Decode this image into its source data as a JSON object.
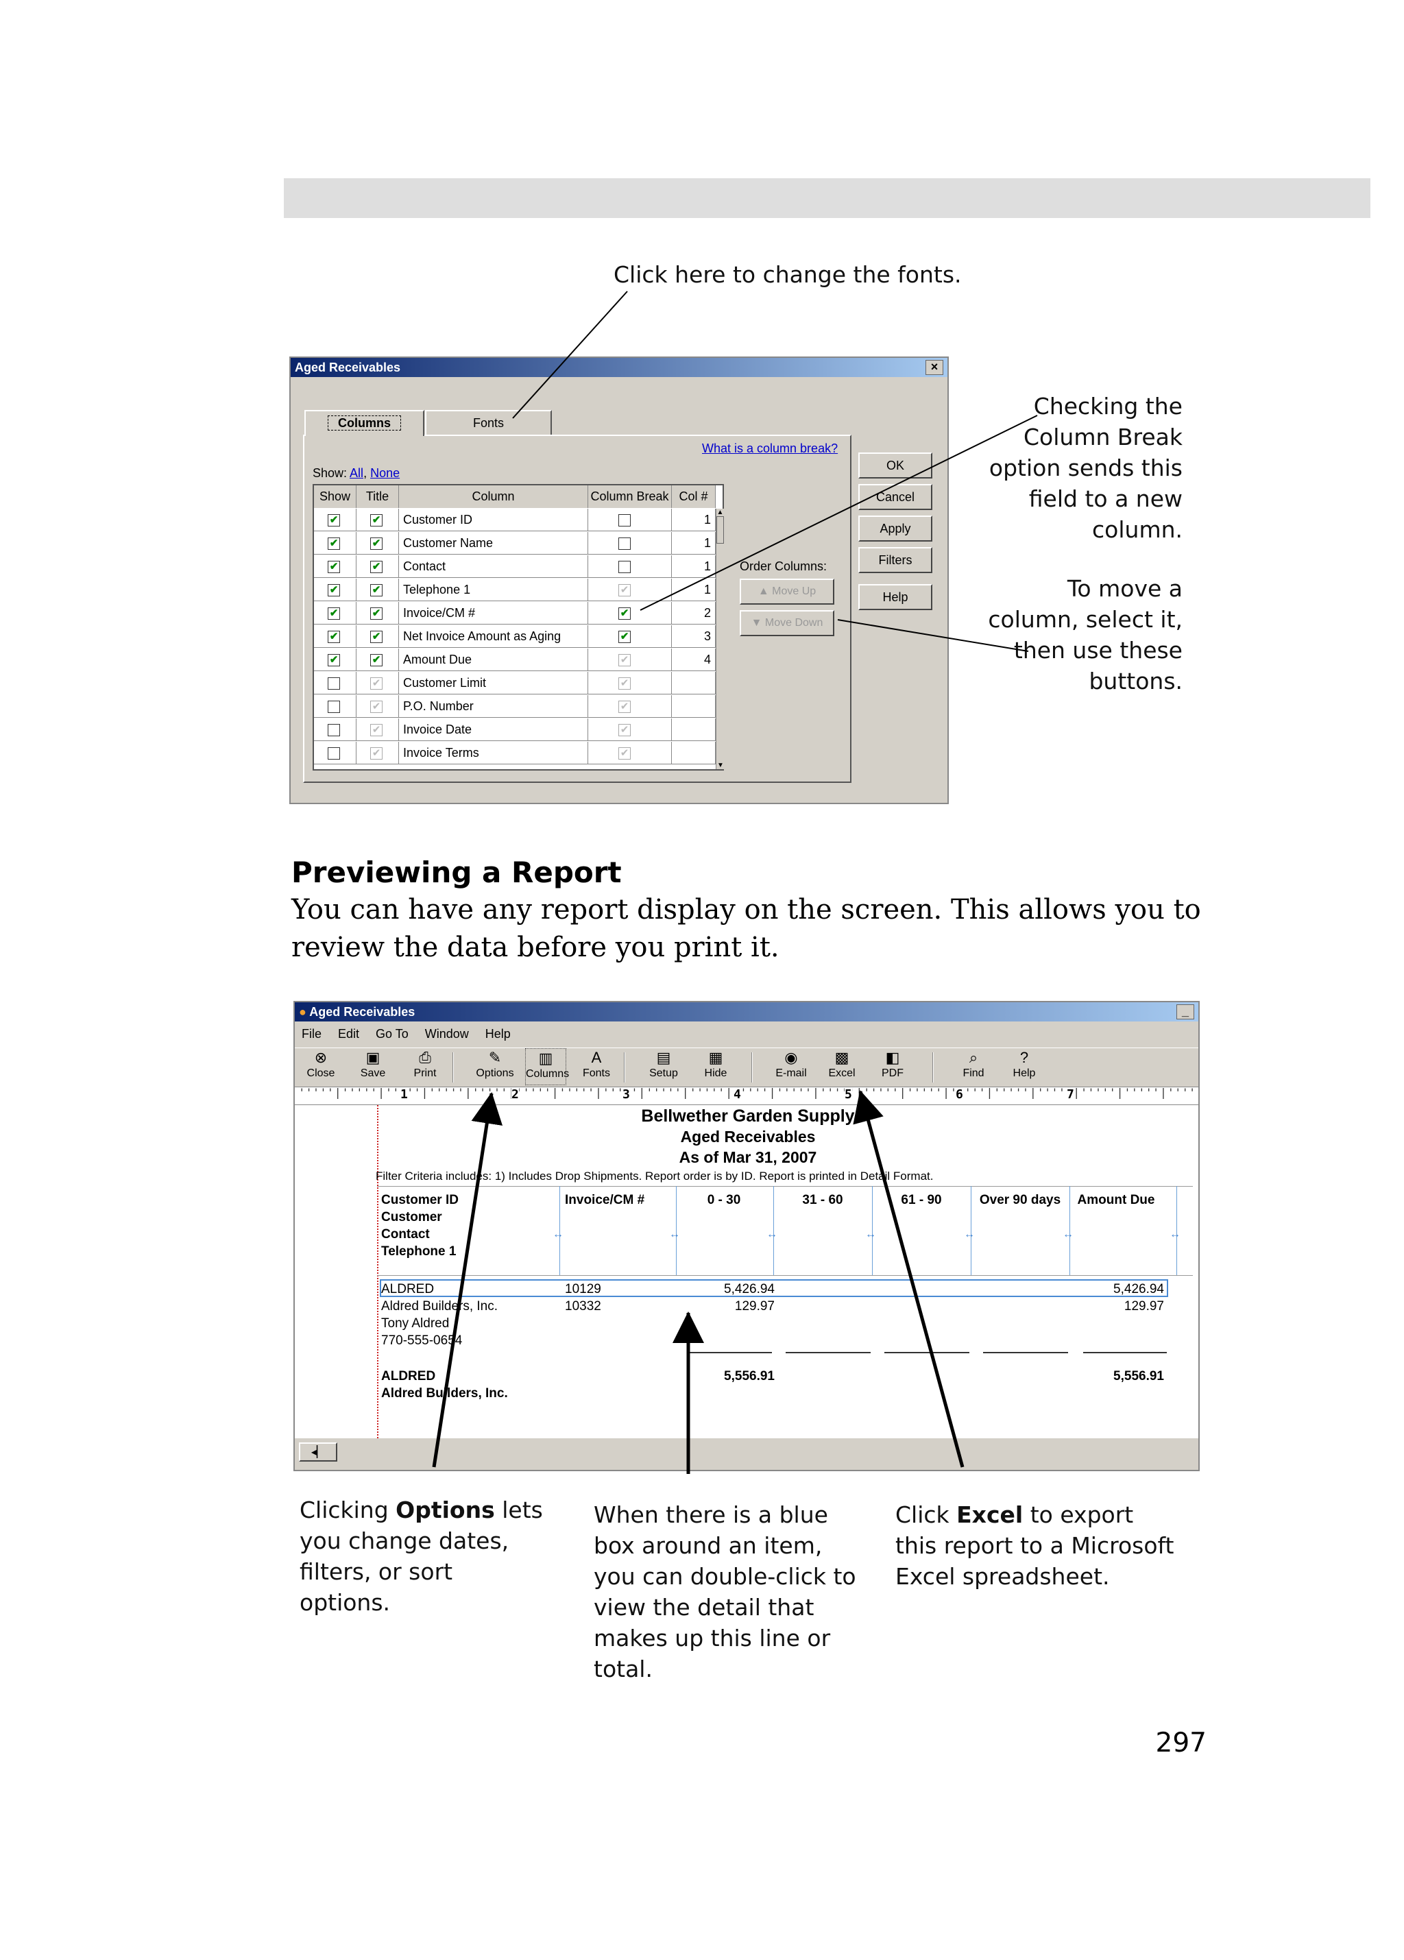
{
  "callouts": {
    "fonts": "Click here to change the fonts.",
    "column_break": [
      "Checking the",
      "Column Break",
      "option sends this",
      "field to a new",
      "column."
    ],
    "move": [
      "To move a",
      "column, select it,",
      "then use these",
      "buttons."
    ],
    "options": {
      "pre": "Clicking ",
      "bold": "Options",
      "post": " lets you change dates, filters, or sort options."
    },
    "blue_box": "When there is a blue box around an item, you can double-click to view the detail that makes up this line or total.",
    "excel": {
      "pre": "Click ",
      "bold": "Excel",
      "post": " to export this report to a Microsoft Excel spreadsheet."
    }
  },
  "section": {
    "heading": "Previewing a Report",
    "body": "You can have any report display on the screen. This allows you to review the data before you print it."
  },
  "page_number": "297",
  "dialog": {
    "title": "Aged Receivables",
    "close": "×",
    "tabs": [
      "Columns",
      "Fonts"
    ],
    "link": "What is a column break?",
    "show_label": "Show:",
    "show_all": "All",
    "show_none": "None",
    "headers": [
      "Show",
      "Title",
      "Column",
      "Column Break",
      "Col #"
    ],
    "rows": [
      {
        "show": true,
        "title": true,
        "column": "Customer ID",
        "brk": "empty",
        "col": "1"
      },
      {
        "show": true,
        "title": true,
        "column": "Customer Name",
        "brk": "empty",
        "col": "1"
      },
      {
        "show": true,
        "title": true,
        "column": "Contact",
        "brk": "empty",
        "col": "1"
      },
      {
        "show": true,
        "title": true,
        "column": "Telephone 1",
        "brk": "gray",
        "col": "1"
      },
      {
        "show": true,
        "title": true,
        "column": "Invoice/CM #",
        "brk": "checked",
        "col": "2"
      },
      {
        "show": true,
        "title": true,
        "column": "Net Invoice Amount as Aging",
        "brk": "checked",
        "col": "3"
      },
      {
        "show": true,
        "title": true,
        "column": "Amount Due",
        "brk": "gray",
        "col": "4"
      },
      {
        "show": false,
        "title": false,
        "column": "Customer Limit",
        "brk": "gray",
        "col": ""
      },
      {
        "show": false,
        "title": false,
        "column": "P.O. Number",
        "brk": "gray",
        "col": ""
      },
      {
        "show": false,
        "title": false,
        "column": "Invoice Date",
        "brk": "gray",
        "col": ""
      },
      {
        "show": false,
        "title": false,
        "column": "Invoice Terms",
        "brk": "gray",
        "col": ""
      }
    ],
    "buttons": [
      "OK",
      "Cancel",
      "Apply",
      "Filters",
      "Help"
    ],
    "order_label": "Order Columns:",
    "move_up": "▲  Move Up",
    "move_down": "▼  Move Down"
  },
  "preview": {
    "title": "Aged Receivables",
    "menu": [
      "File",
      "Edit",
      "Go To",
      "Window",
      "Help"
    ],
    "toolbar": [
      {
        "label": "Close",
        "icon": "⊗",
        "name": "close"
      },
      {
        "label": "Save",
        "icon": "▣",
        "name": "save"
      },
      {
        "label": "Print",
        "icon": "⎙",
        "name": "print"
      },
      {
        "label": "Options",
        "icon": "✎",
        "name": "options"
      },
      {
        "label": "Columns",
        "icon": "▥",
        "name": "columns"
      },
      {
        "label": "Fonts",
        "icon": "A",
        "name": "fonts"
      },
      {
        "label": "Setup",
        "icon": "▤",
        "name": "setup"
      },
      {
        "label": "Hide",
        "icon": "▦",
        "name": "hide"
      },
      {
        "label": "E-mail",
        "icon": "◉",
        "name": "email"
      },
      {
        "label": "Excel",
        "icon": "▩",
        "name": "excel"
      },
      {
        "label": "PDF",
        "icon": "◧",
        "name": "pdf"
      },
      {
        "label": "Find",
        "icon": "⌕",
        "name": "find"
      },
      {
        "label": "Help",
        "icon": "?",
        "name": "help"
      }
    ],
    "ruler_marks": [
      "1",
      "2",
      "3",
      "4",
      "5",
      "6",
      "7"
    ],
    "company": "Bellwether Garden Supply",
    "report_title": "Aged Receivables",
    "as_of": "As of Mar 31, 2007",
    "filter": "Filter Criteria includes: 1) Includes Drop Shipments. Report order is by ID. Report is printed in Detail Format.",
    "col_left": [
      "Customer ID",
      "Customer",
      "Contact",
      "Telephone 1"
    ],
    "col_heads": [
      "Invoice/CM #",
      "0 - 30",
      "31 - 60",
      "61 - 90",
      "Over 90 days",
      "Amount Due"
    ],
    "detail": {
      "id": "ALDRED",
      "name": "Aldred Builders, Inc.",
      "contact": "Tony Aldred",
      "phone": "770-555-0654",
      "lines": [
        {
          "invoice": "10129",
          "b0_30": "5,426.94",
          "due": "5,426.94"
        },
        {
          "invoice": "10332",
          "b0_30": "129.97",
          "due": "129.97"
        }
      ],
      "total_id": "ALDRED",
      "total_name": "Aldred Builders, Inc.",
      "total_0_30": "5,556.91",
      "total_due": "5,556.91"
    }
  }
}
